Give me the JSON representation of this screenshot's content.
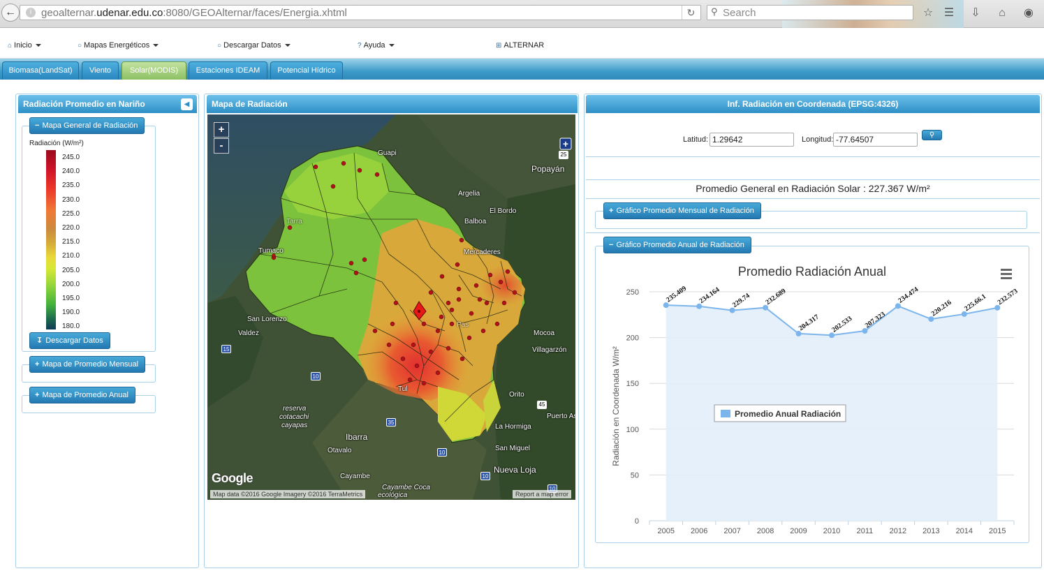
{
  "browser": {
    "url_host_prefix": "geoalternar.",
    "url_host_main": "udenar.edu.co",
    "url_rest": ":8080/GEOAlternar/faces/Energia.xhtml",
    "search_placeholder": "Search"
  },
  "menu": {
    "items": [
      {
        "label": "Inicio",
        "icon": "home-icon"
      },
      {
        "label": "Mapas Energéticos",
        "icon": "user-icon"
      },
      {
        "label": "Descargar Datos",
        "icon": "user-icon"
      },
      {
        "label": "Ayuda",
        "icon": "question-icon"
      },
      {
        "label": "ALTERNAR",
        "icon": "grid-icon"
      }
    ]
  },
  "tabs": [
    {
      "label": "Biomasa(LandSat)",
      "active": false
    },
    {
      "label": "Viento",
      "active": false
    },
    {
      "label": "Solar(MODIS)",
      "active": true
    },
    {
      "label": "Estaciones IDEAM",
      "active": false
    },
    {
      "label": "Potencial Hídrico",
      "active": false
    }
  ],
  "left_panel": {
    "title": "Radiación Promedio en Nariño",
    "general_map": {
      "legend": "Mapa General de Radiación",
      "scale_title": "Radiación (W/m²)",
      "scale_values": [
        "245.0",
        "240.0",
        "235.0",
        "230.0",
        "225.0",
        "220.0",
        "215.0",
        "210.0",
        "205.0",
        "200.0",
        "195.0",
        "190.0",
        "180.0"
      ],
      "download_label": "Descargar Datos"
    },
    "monthly_map": {
      "legend": "Mapa de Promedio Mensual"
    },
    "annual_map": {
      "legend": "Mapa de Promedio Anual"
    }
  },
  "middle_panel": {
    "title": "Mapa de Radiación",
    "zoom_in": "+",
    "zoom_out": "-",
    "labels": {
      "tumaco": "Tumaco",
      "popayan": "Popayán",
      "guapi": "Guapi",
      "argelia": "Argelia",
      "el_bordo": "El Bordo",
      "balboa": "Balboa",
      "mercaderes": "Mercaderes",
      "san_lorenzo": "San Lorenzo",
      "valdez": "Valdez",
      "mocoa": "Mocoa",
      "villagarzon": "Villagarzón",
      "orito": "Orito",
      "puerto_asis": "Puerto As",
      "la_hormiga": "La Hormiga",
      "san_miguel": "San Miguel",
      "nueva_loja": "Nueva Loja",
      "ibarra": "Ibarra",
      "otavalo": "Otavalo",
      "cayambe": "Cayambe",
      "reserva": "reserva",
      "cotacachi": "cotacachi",
      "cayapas": "cayapas",
      "cayambe_coca": "Cayambe Coca",
      "ecologica": "ecológica",
      "tulcan": "Tul",
      "pasto": "Pas",
      "tarra": "Tarra"
    },
    "road_shields": [
      "25",
      "15",
      "10",
      "35",
      "10",
      "45",
      "10",
      "10"
    ],
    "google_logo": "Google",
    "attribution": "Map data ©2016 Google Imagery ©2016 TerraMetrics",
    "report": "Report a map error"
  },
  "right_panel": {
    "title": "Inf. Radiación en Coordenada (EPSG:4326)",
    "lat_label": "Latitud:",
    "lat_value": "1.29642",
    "lon_label": "Longitud:",
    "lon_value": "-77.64507",
    "summary": "Promedio General en Radiación Solar : 227.367 W/m²",
    "monthly_legend": "Gráfico Promedio Mensual de Radiación",
    "annual_legend": "Gráfico Promedio Anual de Radiación"
  },
  "colors": {
    "accent": "#2e8fc6",
    "active_tab": "#8cc063",
    "series_line": "#7cb5ec",
    "series_fill": "#e2eefa"
  },
  "chart_data": {
    "type": "area",
    "title": "Promedio Radiación Anual",
    "xlabel": "",
    "ylabel": "Radiación en Coordenada W/m²",
    "categories": [
      "2005",
      "2006",
      "2007",
      "2008",
      "2009",
      "2010",
      "2011",
      "2012",
      "2013",
      "2014",
      "2015"
    ],
    "series": [
      {
        "name": "Promedio Anual Radiación",
        "values": [
          235.409,
          234.164,
          229.74,
          232.689,
          204.317,
          202.533,
          207.323,
          234.474,
          220.216,
          225.661,
          232.573
        ],
        "labels": [
          "235.409",
          "234.164",
          "229.74",
          "232.689",
          "204.317",
          "202.533",
          "207.323",
          "234.474",
          "220.216",
          "225.66.1",
          "232.573"
        ]
      }
    ],
    "ylim": [
      0,
      250
    ],
    "yticks": [
      0,
      50,
      100,
      150,
      200,
      250
    ],
    "grid": true,
    "legend": "center-left"
  }
}
